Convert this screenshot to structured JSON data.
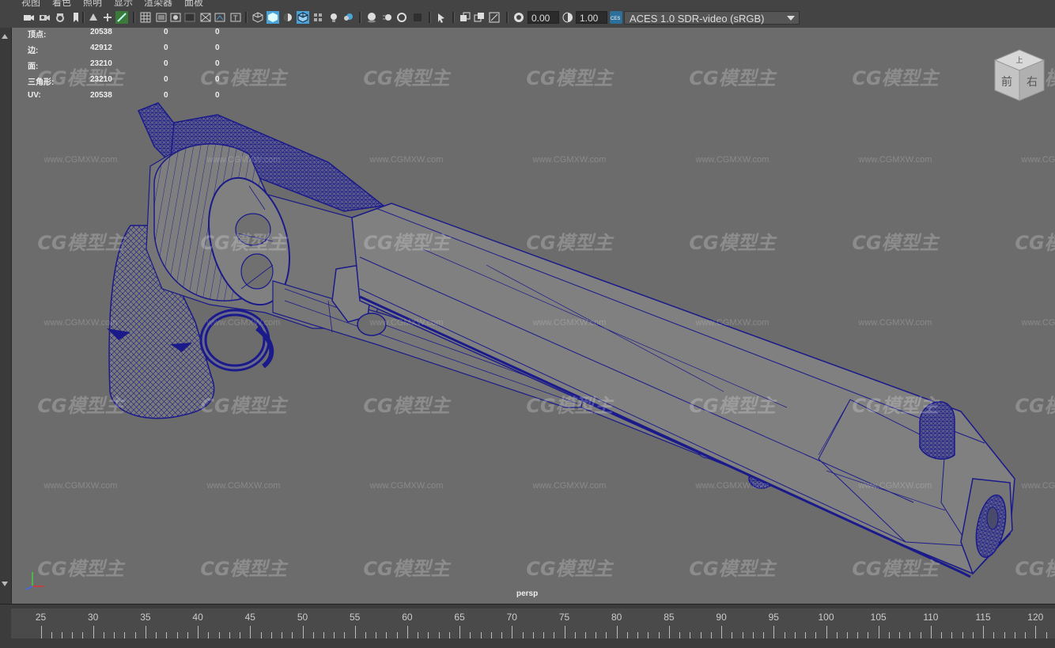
{
  "menu": [
    {
      "id": "view",
      "label": "视图"
    },
    {
      "id": "shading",
      "label": "着色"
    },
    {
      "id": "lighting",
      "label": "照明"
    },
    {
      "id": "show",
      "label": "显示"
    },
    {
      "id": "renderer",
      "label": "渲染器"
    },
    {
      "id": "panels",
      "label": "面板"
    }
  ],
  "toolbar": {
    "exposure_value": "0.00",
    "gamma_value": "1.00",
    "color_space": "ACES 1.0 SDR-video (sRGB)",
    "accent": "#4aa3d8"
  },
  "hud": {
    "rows": [
      {
        "label": "顶点:",
        "total": "20538",
        "selected": "0",
        "triangles": "0"
      },
      {
        "label": "边:",
        "total": "42912",
        "selected": "0",
        "triangles": "0"
      },
      {
        "label": "面:",
        "total": "23210",
        "selected": "0",
        "triangles": "0"
      },
      {
        "label": "三角形:",
        "total": "23210",
        "selected": "0",
        "triangles": "0"
      },
      {
        "label": "UV:",
        "total": "20538",
        "selected": "0",
        "triangles": "0"
      }
    ]
  },
  "viewcube": {
    "top": "上",
    "front": "前",
    "right": "右"
  },
  "camera_label": "persp",
  "watermark": {
    "logo_text": "CG模型主",
    "url_text": "www.CGMXW.com"
  },
  "timeline": {
    "ticks": [
      "25",
      "30",
      "35",
      "40",
      "45",
      "50",
      "55",
      "60",
      "65",
      "70",
      "75",
      "80",
      "85",
      "90",
      "95",
      "100",
      "105",
      "110",
      "115",
      "120"
    ]
  },
  "colors": {
    "wire": "#1a1a8a",
    "mesh": "#7d7d7d",
    "viewport_bg": "#6c6c6c"
  }
}
